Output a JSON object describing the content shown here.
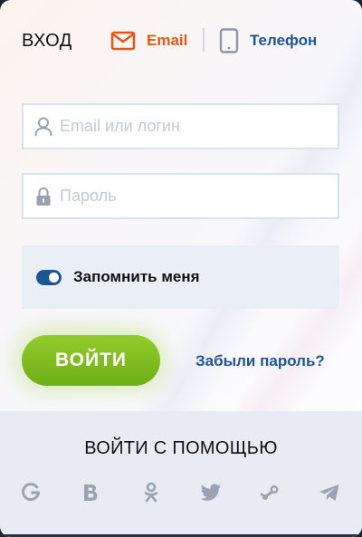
{
  "header": {
    "title": "ВХОД",
    "tabs": [
      {
        "label": "Email",
        "icon": "envelope-icon",
        "color": "#e2581b",
        "active": true
      },
      {
        "label": "Телефон",
        "icon": "smartphone-icon",
        "color": "#1e5692",
        "active": false
      }
    ]
  },
  "form": {
    "login": {
      "placeholder": "Email или логин",
      "value": "",
      "icon": "user-icon"
    },
    "password": {
      "placeholder": "Пароль",
      "value": "",
      "icon": "lock-icon"
    },
    "remember": {
      "label": "Запомнить меня",
      "checked": true
    },
    "submit_label": "ВОЙТИ",
    "forgot_label": "Забыли пароль?"
  },
  "social": {
    "title": "ВОЙТИ С ПОМОЩЬЮ",
    "providers": [
      "google-icon",
      "vk-icon",
      "odnoklassniki-icon",
      "twitter-icon",
      "steam-icon",
      "telegram-icon"
    ]
  },
  "colors": {
    "accent": "#e2581b",
    "brand_blue": "#1e5692",
    "button_green": "#7fbe1f",
    "social_icon": "#9aa3af"
  }
}
